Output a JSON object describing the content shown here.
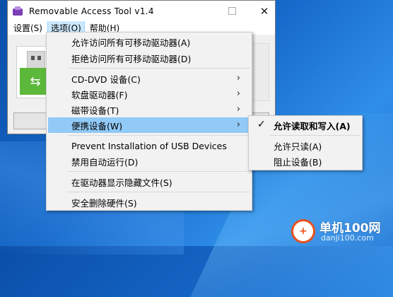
{
  "window": {
    "title": "Removable Access Tool v1.4",
    "close_glyph": "✕"
  },
  "menubar": {
    "items": [
      "设置(S)",
      "选项(O)",
      "帮助(H)"
    ]
  },
  "options_menu": {
    "items": [
      {
        "label": "允许访问所有可移动驱动器(A)"
      },
      {
        "label": "拒绝访问所有可移动驱动器(D)"
      },
      {
        "label": "CD-DVD 设备(C)",
        "submenu": true
      },
      {
        "label": "软盘驱动器(F)",
        "submenu": true
      },
      {
        "label": "磁带设备(T)",
        "submenu": true
      },
      {
        "label": "便携设备(W)",
        "submenu": true,
        "selected": true
      },
      {
        "label": "Prevent Installation of USB Devices"
      },
      {
        "label": "禁用自动运行(D)"
      },
      {
        "label": "在驱动器显示隐藏文件(S)"
      },
      {
        "label": "安全删除硬件(S)"
      }
    ]
  },
  "submenu": {
    "items": [
      {
        "label": "允许读取和写入(A)",
        "checked": true
      },
      {
        "label": "允许只读(A)"
      },
      {
        "label": "阻止设备(B)"
      }
    ]
  },
  "watermark": {
    "title": "单机100网",
    "url": "danji100.com"
  },
  "colors": {
    "menu_highlight": "#91c9f7",
    "usb_green": "#5cb83a",
    "wallpaper": "#1668c9"
  }
}
